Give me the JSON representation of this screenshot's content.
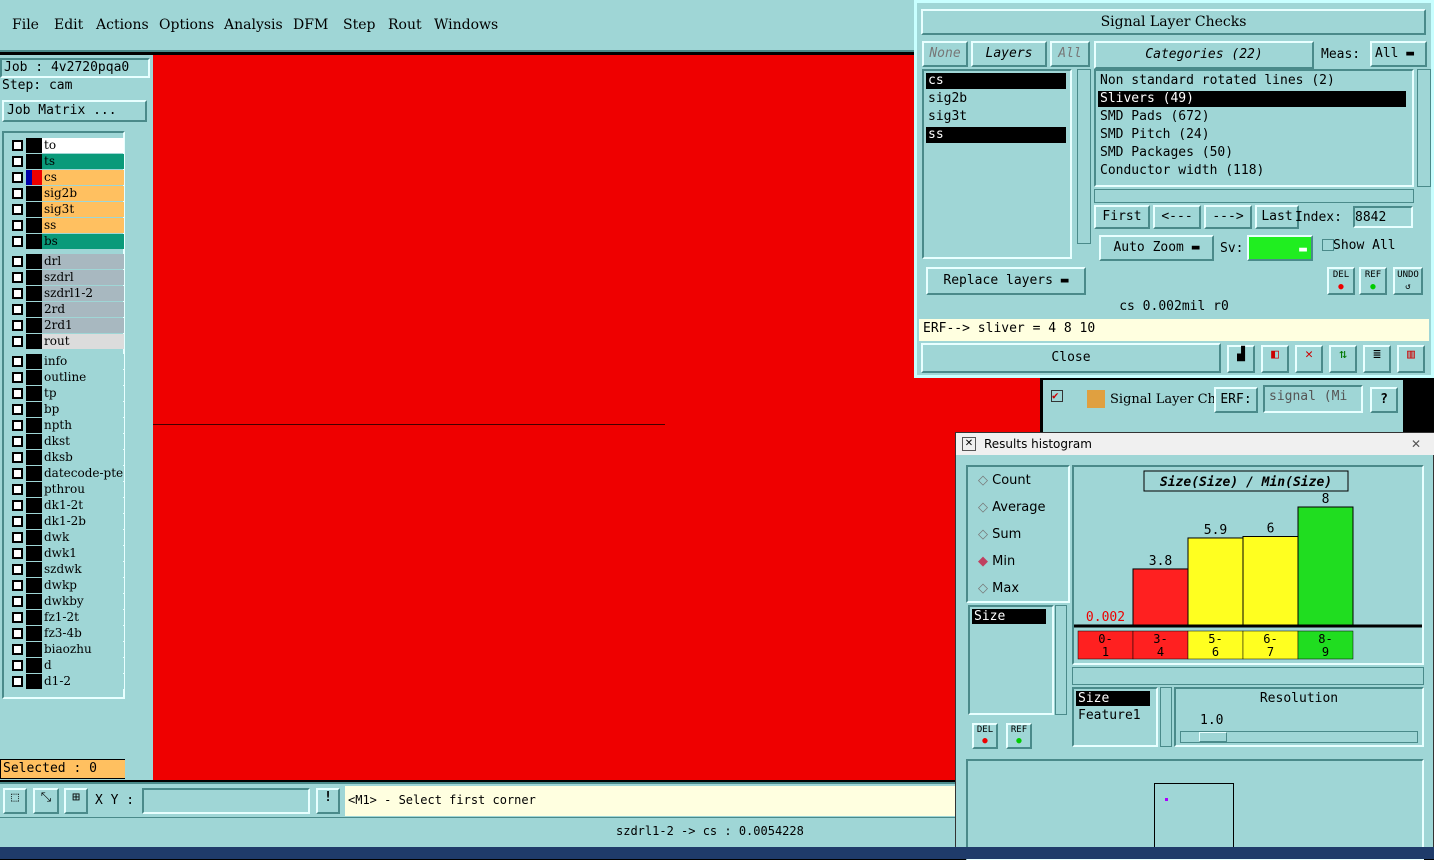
{
  "menu": [
    "File",
    "Edit",
    "Actions",
    "Options",
    "Analysis",
    "DFM",
    "Step",
    "Rout",
    "Windows"
  ],
  "job": {
    "label": "Job : 4v2720pqa0",
    "step": "Step: cam",
    "matrix_button": "Job Matrix ..."
  },
  "layers": [
    {
      "name": "to",
      "color": "#ffffff",
      "sel": false
    },
    {
      "name": "ts",
      "color": "#0a9a7a",
      "sel": false
    },
    {
      "name": "cs",
      "color": "#ffc060",
      "sel": true
    },
    {
      "name": "sig2b",
      "color": "#ffc060",
      "sel": false
    },
    {
      "name": "sig3t",
      "color": "#ffc060",
      "sel": false
    },
    {
      "name": "ss",
      "color": "#ffc060",
      "sel": false
    },
    {
      "name": "bs",
      "color": "#0a9a7a",
      "sel": false
    },
    {
      "name": "drl",
      "color": "#a8b8c0",
      "sel": false
    },
    {
      "name": "szdrl",
      "color": "#a8b8c0",
      "sel": false
    },
    {
      "name": "szdrl1-2",
      "color": "#a8b8c0",
      "sel": false
    },
    {
      "name": "2rd",
      "color": "#a8b8c0",
      "sel": false
    },
    {
      "name": "2rd1",
      "color": "#a8b8c0",
      "sel": false
    },
    {
      "name": "rout",
      "color": "#dcdcdc",
      "sel": false
    },
    {
      "name": "info",
      "color": "#9fd6d6",
      "sel": false
    },
    {
      "name": "outline",
      "color": "#9fd6d6",
      "sel": false
    },
    {
      "name": "tp",
      "color": "#9fd6d6",
      "sel": false
    },
    {
      "name": "bp",
      "color": "#9fd6d6",
      "sel": false
    },
    {
      "name": "npth",
      "color": "#9fd6d6",
      "sel": false
    },
    {
      "name": "dkst",
      "color": "#9fd6d6",
      "sel": false
    },
    {
      "name": "dksb",
      "color": "#9fd6d6",
      "sel": false
    },
    {
      "name": "datecode-pte",
      "color": "#9fd6d6",
      "sel": false
    },
    {
      "name": "pthrou",
      "color": "#9fd6d6",
      "sel": false
    },
    {
      "name": "dk1-2t",
      "color": "#9fd6d6",
      "sel": false
    },
    {
      "name": "dk1-2b",
      "color": "#9fd6d6",
      "sel": false
    },
    {
      "name": "dwk",
      "color": "#9fd6d6",
      "sel": false
    },
    {
      "name": "dwk1",
      "color": "#9fd6d6",
      "sel": false
    },
    {
      "name": "szdwk",
      "color": "#9fd6d6",
      "sel": false
    },
    {
      "name": "dwkp",
      "color": "#9fd6d6",
      "sel": false
    },
    {
      "name": "dwkby",
      "color": "#9fd6d6",
      "sel": false
    },
    {
      "name": "fz1-2t",
      "color": "#9fd6d6",
      "sel": false
    },
    {
      "name": "fz3-4b",
      "color": "#9fd6d6",
      "sel": false
    },
    {
      "name": "biaozhu",
      "color": "#9fd6d6",
      "sel": false
    },
    {
      "name": "d",
      "color": "#9fd6d6",
      "sel": false
    },
    {
      "name": "d1-2",
      "color": "#9fd6d6",
      "sel": false
    }
  ],
  "selected_label": "Selected : 0",
  "bottom": {
    "xy_label": "X Y :",
    "xy_value": "",
    "prompt": "<M1> - Select first corner",
    "status": "szdrl1-2 -> cs : 0.0054228"
  },
  "checks": {
    "title": "Signal Layer Checks",
    "none_btn": "None",
    "layers_btn": "Layers",
    "all_btn": "All",
    "categories_btn": "Categories (22)",
    "meas_label": "Meas:",
    "meas_value": "All",
    "layer_list": [
      {
        "name": "cs",
        "sel": true
      },
      {
        "name": "sig2b",
        "sel": false
      },
      {
        "name": "sig3t",
        "sel": false
      },
      {
        "name": "ss",
        "sel": true
      }
    ],
    "categories": [
      {
        "name": "Non standard rotated lines (2)",
        "sel": false
      },
      {
        "name": "Slivers (49)",
        "sel": true
      },
      {
        "name": "SMD Pads (672)",
        "sel": false
      },
      {
        "name": "SMD Pitch (24)",
        "sel": false
      },
      {
        "name": "SMD Packages (50)",
        "sel": false
      },
      {
        "name": "Conductor width (118)",
        "sel": false
      }
    ],
    "first": "First",
    "prev": "<---",
    "next": "--->",
    "last": "Last",
    "index_label": "Index:",
    "index_value": "8842",
    "autozoom": "Auto Zoom",
    "sv_label": "Sv:",
    "show_all": "Show All",
    "replace_layers": "Replace layers",
    "del": "DEL",
    "ref": "REF",
    "undo": "UNDO",
    "info_line": "cs 0.002mil  r0",
    "erf_line": "ERF--> sliver = 4 8 10",
    "close": "Close"
  },
  "signal_bar": {
    "title": "Signal Layer Ch",
    "erf_label": "ERF:",
    "erf_value": "signal (Mi",
    "help": "?"
  },
  "histogram": {
    "title": "Results histogram",
    "modes": [
      "Count",
      "Average",
      "Sum",
      "Min",
      "Max"
    ],
    "selected_mode": "Min",
    "field_list": [
      "Size"
    ],
    "del": "DEL",
    "ref": "REF",
    "resolution_label": "Resolution",
    "resolution_value": "1.0",
    "param_list": [
      "Size",
      "Feature1"
    ]
  },
  "chart_data": {
    "type": "bar",
    "title": "Size(Size) / Min(Size)",
    "categories": [
      "0-1",
      "3-4",
      "5-6",
      "6-7",
      "8-9"
    ],
    "values": [
      0.002,
      3.8,
      5.9,
      6,
      8
    ],
    "value_labels": [
      "0.002",
      "3.8",
      "5.9",
      "6",
      "8"
    ],
    "colors": [
      "#ff2020",
      "#ff2020",
      "#ffff20",
      "#ffff20",
      "#20dd20"
    ],
    "ylim": [
      0,
      8
    ]
  }
}
